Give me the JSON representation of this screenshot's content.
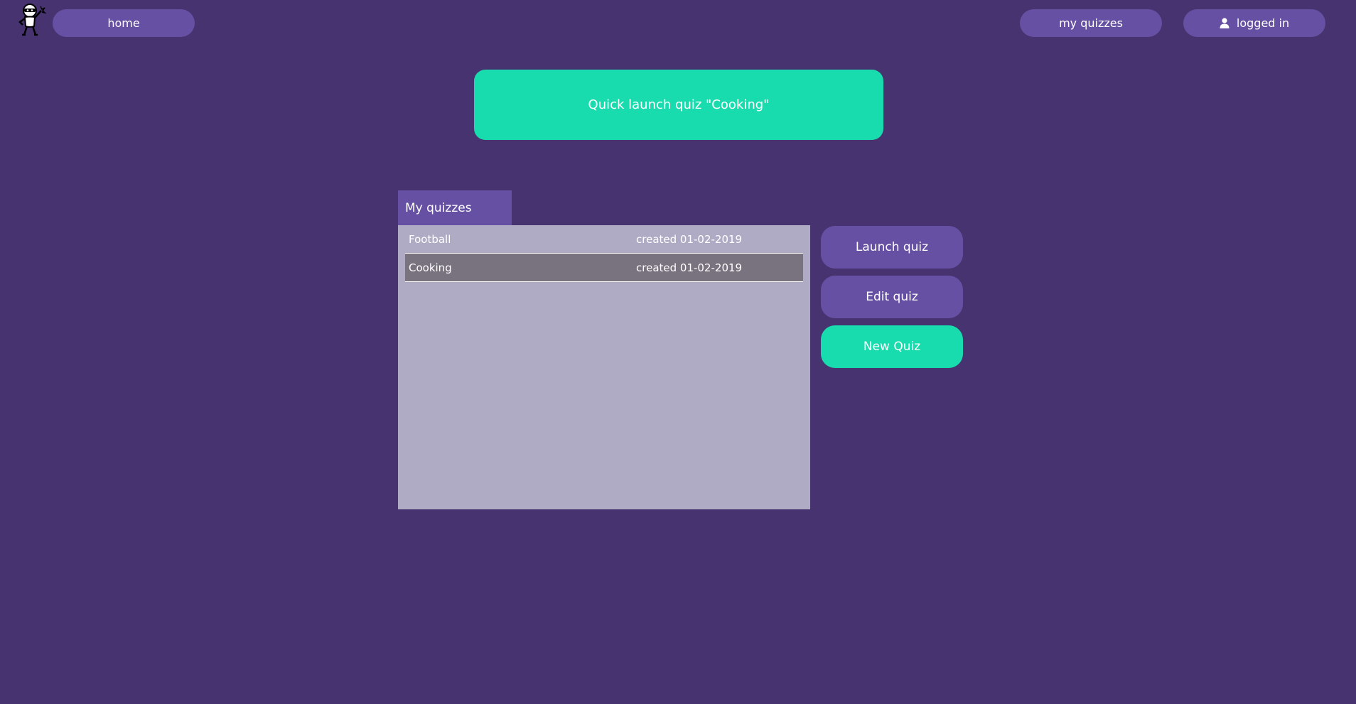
{
  "nav": {
    "home_label": "home",
    "my_quizzes_label": "my quizzes",
    "login_label": "logged in",
    "user_icon": "user-icon"
  },
  "quick_launch": {
    "label": "Quick launch quiz \"Cooking\""
  },
  "quizzes_panel": {
    "title": "My quizzes",
    "items": [
      {
        "name": "Football",
        "created": "created 01-02-2019",
        "selected": false
      },
      {
        "name": "Cooking",
        "created": "created 01-02-2019",
        "selected": true
      }
    ]
  },
  "actions": {
    "launch_label": "Launch quiz",
    "edit_label": "Edit quiz",
    "new_label": "New Quiz"
  },
  "colors": {
    "background": "#46336f",
    "purple": "#6650a3",
    "teal": "#19dcae",
    "panel": "#b0abc4",
    "selected_row": "#79727f"
  }
}
